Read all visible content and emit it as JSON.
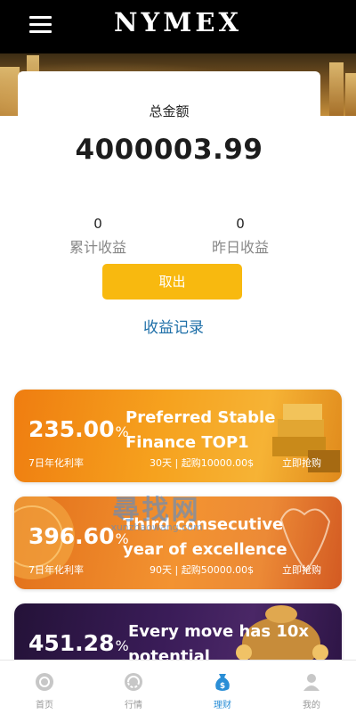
{
  "header": {
    "brand": "NYMEX",
    "menu_icon": "hamburger-menu-icon"
  },
  "summary": {
    "total_label": "总金额",
    "total_value": "4000003.99",
    "cumulative": {
      "value": "0",
      "label": "累计收益"
    },
    "yesterday": {
      "value": "0",
      "label": "昨日收益"
    },
    "withdraw_label": "取出",
    "records_label": "收益记录"
  },
  "products": [
    {
      "rate": "235.00",
      "rate_unit": "%",
      "rate_label": "7日年化利率",
      "title": "Preferred Stable Finance TOP1",
      "terms": "30天 | 起购10000.00$",
      "buy_label": "立即抢购"
    },
    {
      "rate": "396.60",
      "rate_unit": "%",
      "rate_label": "7日年化利率",
      "title": "Third consecutive year of excellence",
      "terms": "90天 | 起购50000.00$",
      "buy_label": "立即抢购"
    },
    {
      "rate": "451.28",
      "rate_unit": "%",
      "title": "Every move has 10x potential"
    }
  ],
  "watermark": {
    "big": "尋找网",
    "small": "xunzhaowang.com"
  },
  "tabbar": {
    "items": [
      {
        "label": "首页",
        "icon": "home-icon"
      },
      {
        "label": "行情",
        "icon": "market-icon"
      },
      {
        "label": "理财",
        "icon": "wealth-bag-icon",
        "active": true
      },
      {
        "label": "我的",
        "icon": "profile-icon"
      }
    ]
  },
  "colors": {
    "accent": "#f8b90f",
    "link": "#1e6fa8",
    "active_tab": "#2a8ed6",
    "header_bg": "#000000"
  }
}
